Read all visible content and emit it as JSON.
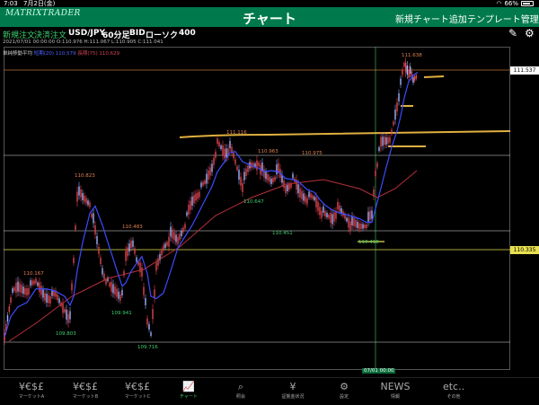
{
  "status": {
    "time": "7:03",
    "date": "7月2日(金)",
    "battery": "66%"
  },
  "header": {
    "logo": "MATRIXTRADER",
    "title": "チャート",
    "add_chart": "新規チャート追加",
    "template": "テンプレート管理"
  },
  "toolbar": {
    "new_order": "新規注文",
    "settle_order": "決済注文",
    "pair": "USD/JPY",
    "timeframe": "60分足",
    "side": "BID",
    "chart_type": "ローソク",
    "count": "400"
  },
  "info": {
    "ohlc": "2021/07/01 00:00:00   O:110.976  H:111.067  L:110.905  C:111.041"
  },
  "legend": {
    "label": "単純移動平均",
    "short": "短期(20) 110.579",
    "long": "長期(75) 110.629"
  },
  "price_axis": {
    "top": "111.537",
    "bottom": "110.335"
  },
  "annotations": {
    "p1": "110.823",
    "p2": "110.167",
    "p3": "109.803",
    "p4": "110.483",
    "p5": "109.941",
    "p6": "109.716",
    "p7": "111.116",
    "p8": "110.963",
    "p9": "110.647",
    "p10": "110.975",
    "p11": "110.451",
    "p12": "110.410",
    "p13": "111.638",
    "cursor": "07/01 00:00"
  },
  "colors": {
    "accent": "#007a4d",
    "up": "#e2454f",
    "sma_short": "#3b4cff",
    "sma_long": "#b8303a",
    "hline": "#e0b040"
  },
  "tabs": [
    {
      "icon": "¥€$£",
      "label": "マーケットA"
    },
    {
      "icon": "¥€$£",
      "label": "マーケットB"
    },
    {
      "icon": "¥€$£",
      "label": "マーケットC"
    },
    {
      "icon": "chart",
      "label": "チャート"
    },
    {
      "icon": "search",
      "label": "照会"
    },
    {
      "icon": "¥",
      "label": "証拠金状況"
    },
    {
      "icon": "gear",
      "label": "設定"
    },
    {
      "icon": "NEWS",
      "label": "情報"
    },
    {
      "icon": "etc..",
      "label": "その他"
    }
  ]
}
